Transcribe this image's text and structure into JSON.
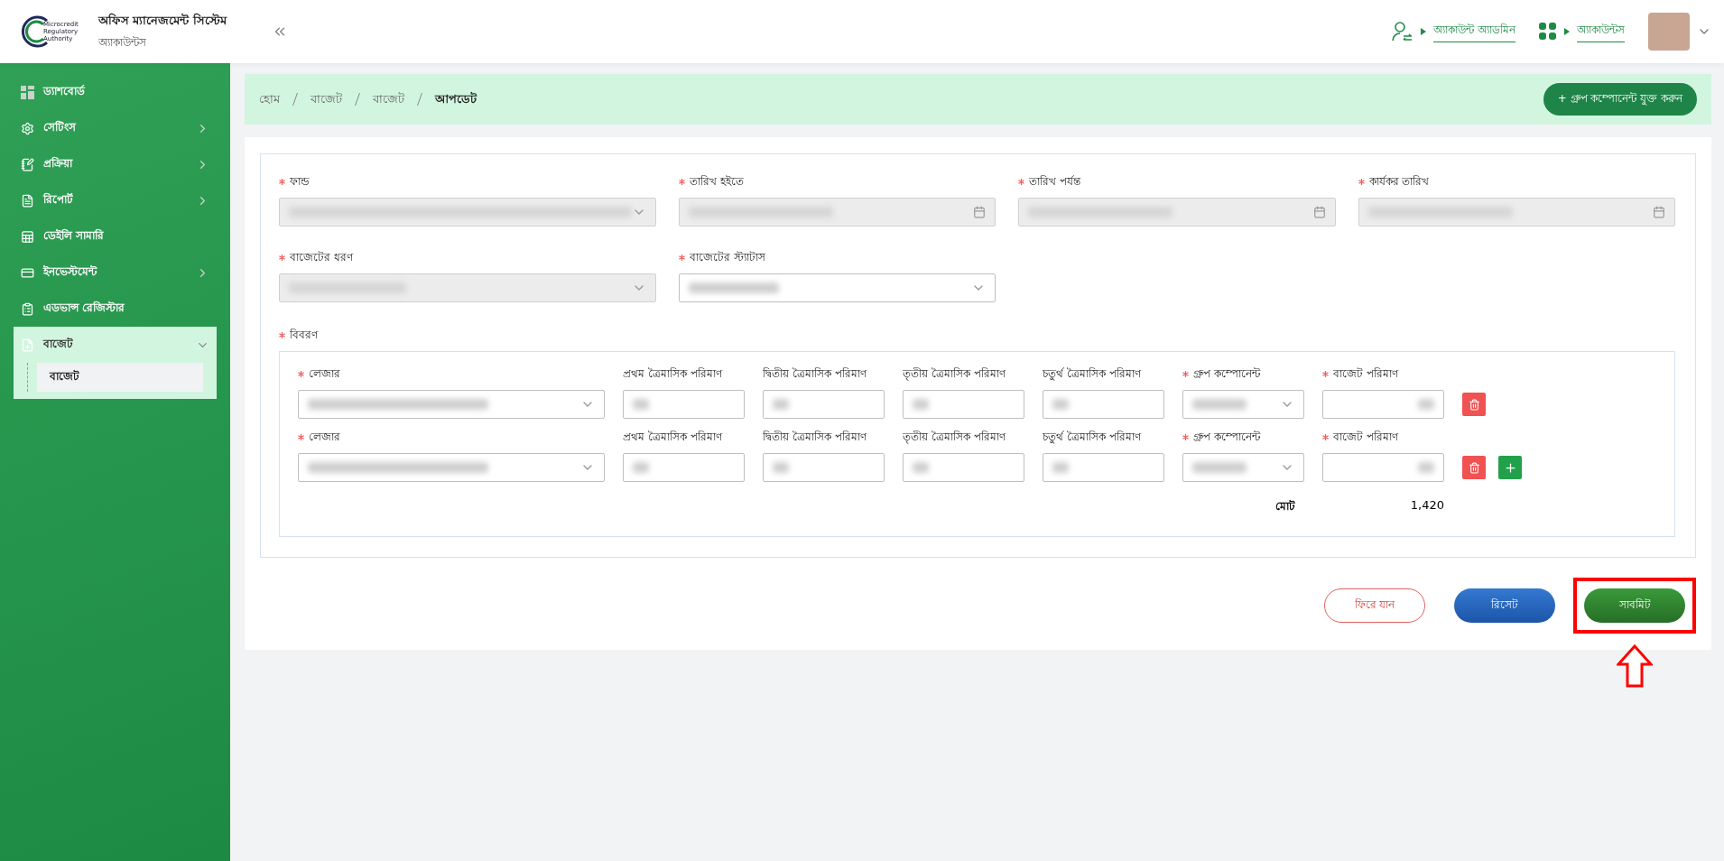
{
  "header": {
    "logo_text": [
      "Microcredit",
      "Regulatory",
      "Authority"
    ],
    "title": "অফিস ম্যানেজমেন্ট সিস্টেম",
    "subtitle": "অ্যাকাউন্টস",
    "links": [
      {
        "kind": "user",
        "label": "অ্যাকাউন্ট অ্যাডমিন"
      },
      {
        "kind": "apps",
        "label": "অ্যাকাউন্টস"
      }
    ]
  },
  "sidebar": {
    "items": [
      {
        "label": "ড্যাশবোর্ড",
        "has_children": false,
        "selected": false
      },
      {
        "label": "সেটিংস",
        "has_children": true,
        "expanded": false,
        "selected": false
      },
      {
        "label": "প্রক্রিয়া",
        "has_children": true,
        "expanded": false,
        "selected": false
      },
      {
        "label": "রিপোর্ট",
        "has_children": true,
        "expanded": false,
        "selected": false
      },
      {
        "label": "ডেইলি সামারি",
        "has_children": false,
        "selected": false
      },
      {
        "label": "ইনভেস্টমেন্ট",
        "has_children": true,
        "expanded": false,
        "selected": false
      },
      {
        "label": "এডভান্স রেজিস্টার",
        "has_children": false,
        "selected": false
      },
      {
        "label": "বাজেট",
        "has_children": true,
        "expanded": true,
        "selected": true,
        "children": [
          {
            "label": "বাজেট",
            "selected": true
          }
        ]
      }
    ]
  },
  "breadcrumb": [
    "হোম",
    "বাজেট",
    "বাজেট",
    "আপডেট"
  ],
  "add_button": "+ গ্রুপ কম্পোনেন্ট যুক্ত করুন",
  "fields": [
    {
      "label": "ফান্ড",
      "kind": "select",
      "required": true,
      "disabled": true
    },
    {
      "label": "তারিখ হইতে",
      "kind": "date",
      "required": true,
      "disabled": true
    },
    {
      "label": "তারিখ পর্যন্ত",
      "kind": "date",
      "required": true,
      "disabled": true
    },
    {
      "label": "কার্যকর তারিখ",
      "kind": "date",
      "required": true,
      "disabled": true
    },
    {
      "label": "বাজেটের ধরণ",
      "kind": "select",
      "required": true,
      "disabled": true
    },
    {
      "label": "বাজেটের স্ট্যাটাস",
      "kind": "select",
      "required": true,
      "disabled": false
    }
  ],
  "details": {
    "label": "বিবরণ",
    "required": true,
    "rows": [
      {
        "can_add": false,
        "cells": [
          {
            "label": "লেজার",
            "kind": "select",
            "required": true
          },
          {
            "label": "প্রথম ত্রৈমাসিক পরিমাণ",
            "kind": "input",
            "required": false
          },
          {
            "label": "দ্বিতীয় ত্রৈমাসিক পরিমাণ",
            "kind": "input",
            "required": false
          },
          {
            "label": "তৃতীয় ত্রৈমাসিক পরিমাণ",
            "kind": "input",
            "required": false
          },
          {
            "label": "চতুর্থ ত্রৈমাসিক পরিমাণ",
            "kind": "input",
            "required": false
          },
          {
            "label": "গ্রুপ কম্পোনেন্ট",
            "kind": "select",
            "required": true
          },
          {
            "label": "বাজেট পরিমাণ",
            "kind": "amount",
            "required": true
          }
        ]
      },
      {
        "can_add": true,
        "cells": [
          {
            "label": "লেজার",
            "kind": "select",
            "required": true
          },
          {
            "label": "প্রথম ত্রৈমাসিক পরিমাণ",
            "kind": "input",
            "required": false
          },
          {
            "label": "দ্বিতীয় ত্রৈমাসিক পরিমাণ",
            "kind": "input",
            "required": false
          },
          {
            "label": "তৃতীয় ত্রৈমাসিক পরিমাণ",
            "kind": "input",
            "required": false
          },
          {
            "label": "চতুর্থ ত্রৈমাসিক পরিমাণ",
            "kind": "input",
            "required": false
          },
          {
            "label": "গ্রুপ কম্পোনেন্ট",
            "kind": "select",
            "required": true
          },
          {
            "label": "বাজেট পরিমাণ",
            "kind": "amount",
            "required": true
          }
        ]
      }
    ],
    "total_label": "মোট",
    "total": "1,420"
  },
  "buttons": [
    {
      "label": "ফিরে যান",
      "kind": "back",
      "highlighted": false
    },
    {
      "label": "রিসেট",
      "kind": "reset",
      "highlighted": false
    },
    {
      "label": "সাবমিট",
      "kind": "submit",
      "highlighted": true
    }
  ]
}
